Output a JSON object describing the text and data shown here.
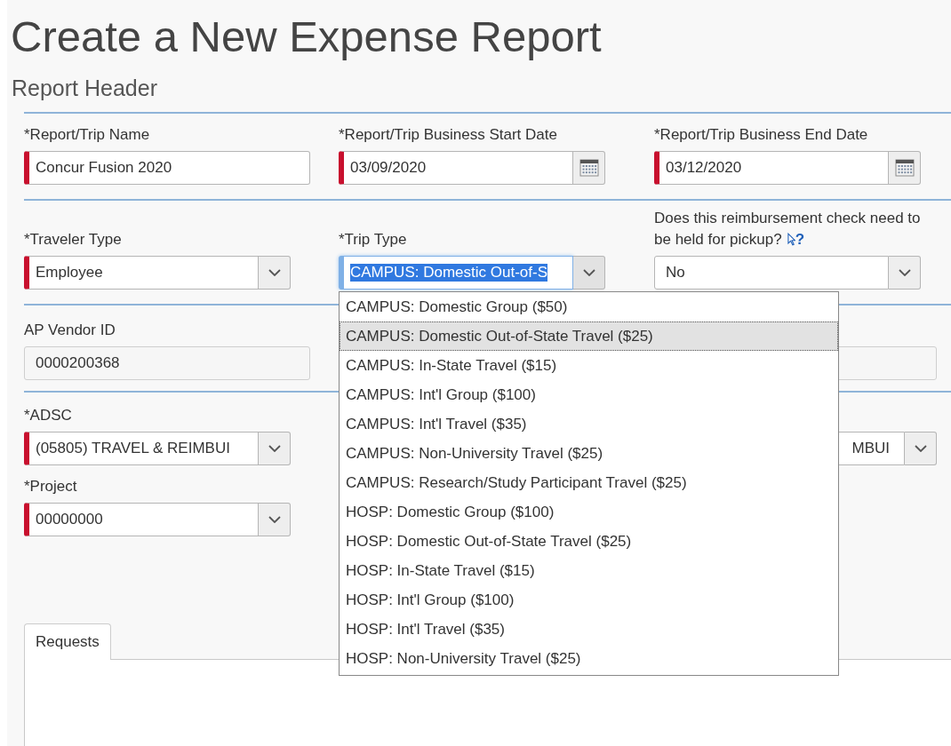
{
  "title": "Create a New Expense Report",
  "subtitle": "Report Header",
  "sections": [
    {
      "rows": [
        [
          {
            "kind": "text",
            "label": "*Report/Trip Name",
            "value": "Concur Fusion 2020",
            "required": true
          },
          {
            "kind": "date",
            "label": "*Report/Trip Business Start Date",
            "value": "03/09/2020",
            "required": true
          },
          {
            "kind": "date",
            "label": "*Report/Trip Business End Date",
            "value": "03/12/2020",
            "required": true
          }
        ]
      ]
    },
    {
      "rows": [
        [
          {
            "kind": "select",
            "label": "*Traveler Type",
            "value": "Employee",
            "required": true
          },
          {
            "kind": "select",
            "label": "*Trip Type",
            "value": "CAMPUS: Domestic Out-of-S",
            "required": true,
            "focused": true,
            "expanded": true,
            "options": [
              {
                "label": "CAMPUS: Domestic Group ($50)",
                "selected": false
              },
              {
                "label": "CAMPUS: Domestic Out-of-State Travel ($25)",
                "selected": true
              },
              {
                "label": "CAMPUS: In-State Travel ($15)",
                "selected": false
              },
              {
                "label": "CAMPUS: Int'l Group ($100)",
                "selected": false
              },
              {
                "label": "CAMPUS: Int'l Travel ($35)",
                "selected": false
              },
              {
                "label": "CAMPUS: Non-University Travel ($25)",
                "selected": false
              },
              {
                "label": "CAMPUS: Research/Study Participant Travel ($25)",
                "selected": false
              },
              {
                "label": "HOSP: Domestic Group ($100)",
                "selected": false
              },
              {
                "label": "HOSP: Domestic Out-of-State Travel ($25)",
                "selected": false
              },
              {
                "label": "HOSP: In-State Travel ($15)",
                "selected": false
              },
              {
                "label": "HOSP: Int'l Group ($100)",
                "selected": false
              },
              {
                "label": "HOSP: Int'l Travel ($35)",
                "selected": false
              },
              {
                "label": "HOSP: Non-University Travel ($25)",
                "selected": false
              }
            ]
          },
          {
            "kind": "select",
            "label": "Does this reimbursement check need to be held for pickup?",
            "help": "?",
            "value": "No",
            "required": false
          }
        ]
      ]
    },
    {
      "rows": [
        [
          {
            "kind": "text",
            "label": "AP Vendor ID",
            "value": "0000200368",
            "required": false,
            "disabled": true
          },
          null,
          {
            "kind": "text",
            "required": false,
            "disabled": true
          }
        ]
      ]
    },
    {
      "rows": [
        [
          {
            "kind": "select",
            "label": "*ADSC",
            "value": "(05805) TRAVEL & REIMBUI",
            "required": true
          },
          null,
          {
            "kind": "select",
            "value": "MBUI",
            "required": false,
            "cut": true
          }
        ],
        [
          {
            "kind": "select",
            "label": "*Project",
            "value": "00000000",
            "required": true
          },
          null,
          null
        ]
      ]
    }
  ],
  "tabs": [
    {
      "label": "Requests",
      "selected": true
    }
  ]
}
